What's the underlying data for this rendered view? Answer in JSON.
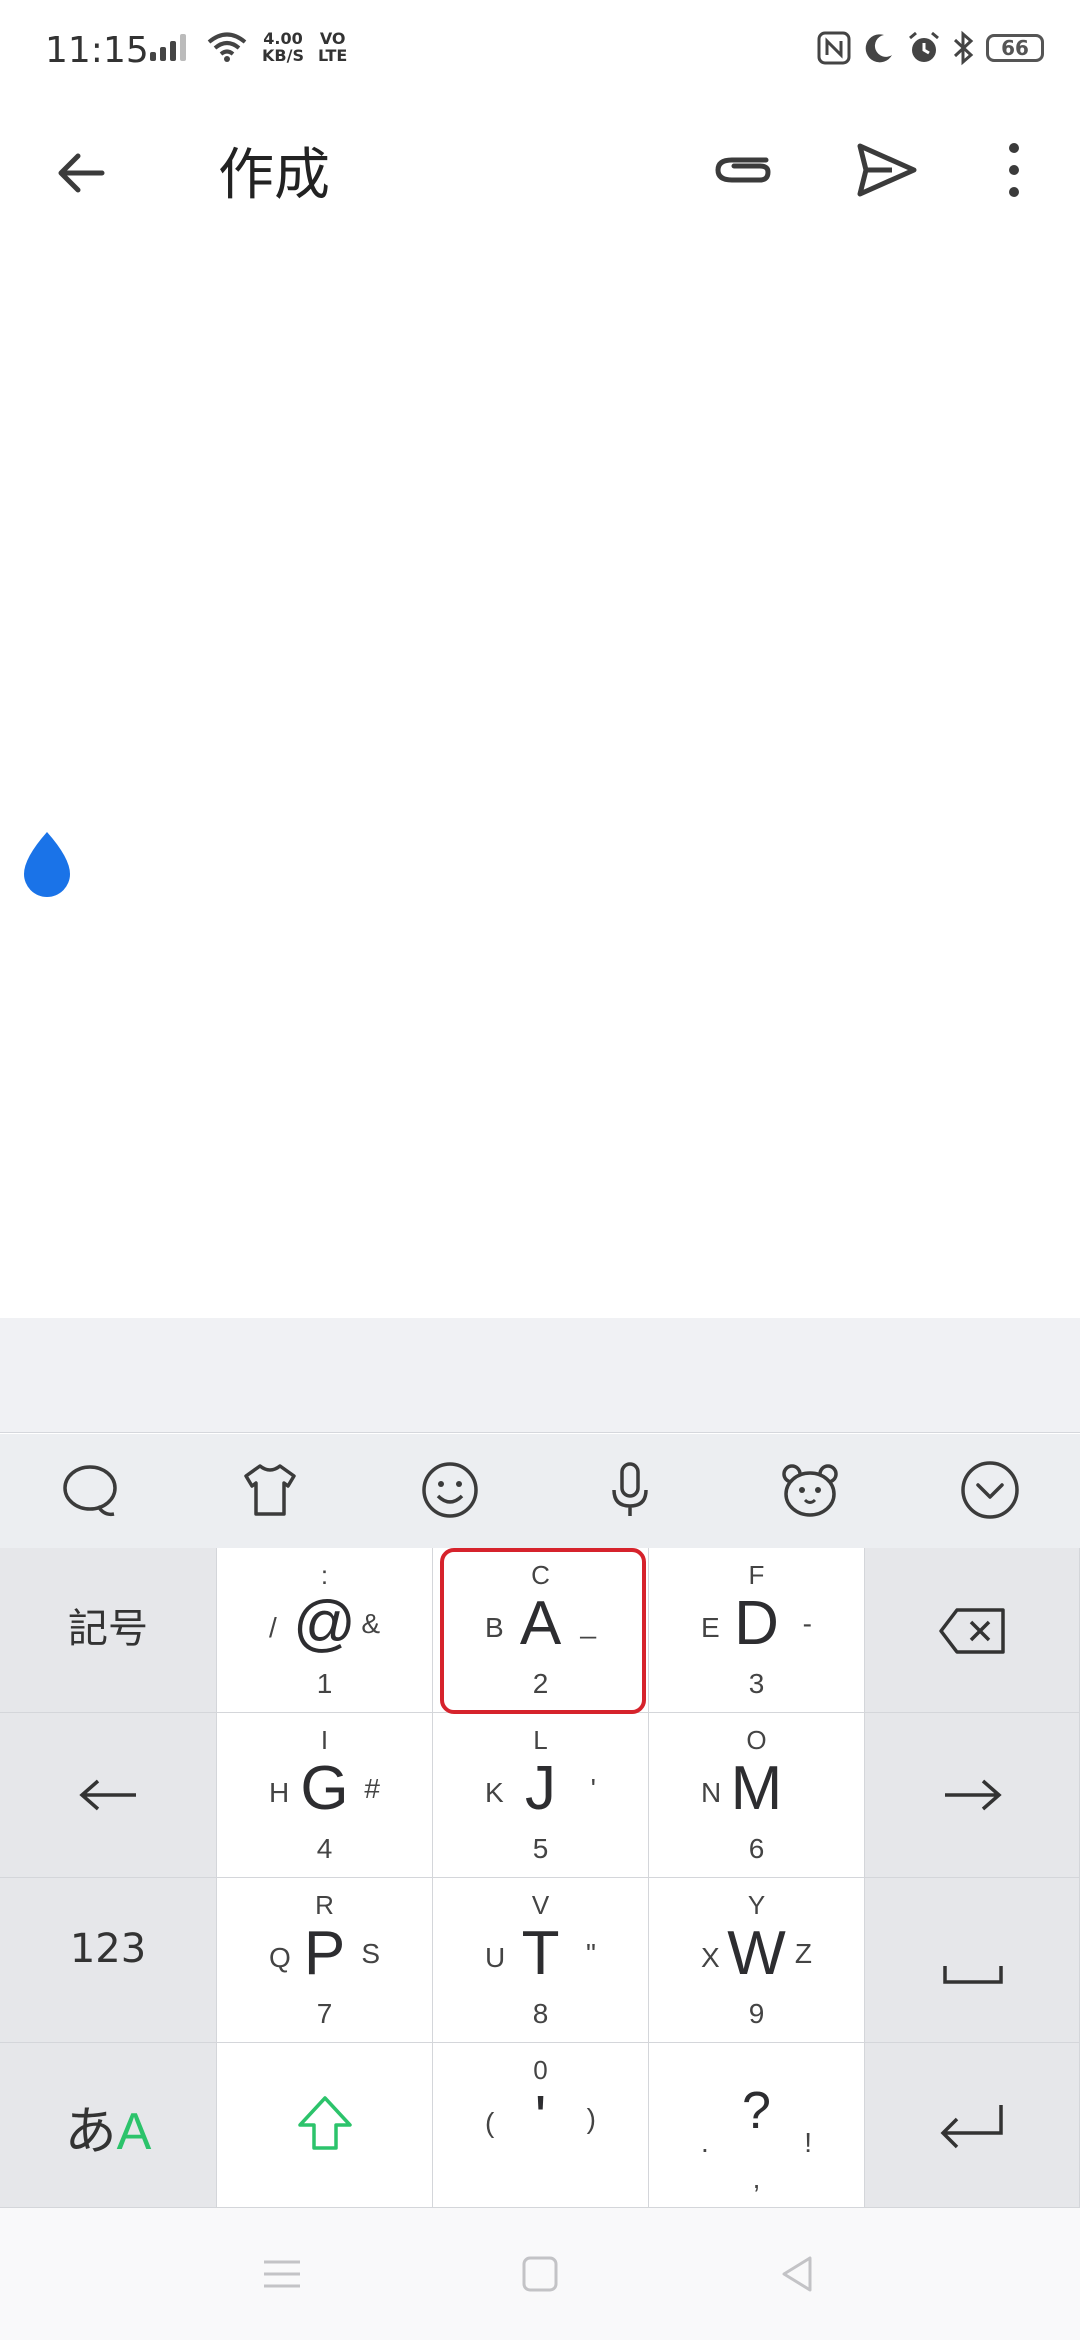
{
  "status": {
    "time": "11:15",
    "speed_top": "4.00",
    "speed_bottom": "KB/S",
    "volte_top": "VO",
    "volte_bottom": "LTE",
    "battery": "66"
  },
  "appbar": {
    "title": "作成"
  },
  "keyboard": {
    "side_left": [
      "記号",
      "",
      "123",
      ""
    ],
    "lang_toggle_a": "あ",
    "lang_toggle_b": "A",
    "keys": [
      {
        "top": ":",
        "left": "/",
        "main": "@",
        "right": "&",
        "bottom": "1"
      },
      {
        "top": "C",
        "left": "B",
        "main": "A",
        "right": "_",
        "bottom": "2"
      },
      {
        "top": "F",
        "left": "E",
        "main": "D",
        "right": "-",
        "bottom": "3"
      },
      {
        "top": "I",
        "left": "H",
        "main": "G",
        "right": "#",
        "bottom": "4"
      },
      {
        "top": "L",
        "left": "K",
        "main": "J",
        "right": "'",
        "bottom": "5"
      },
      {
        "top": "O",
        "left": "N",
        "main": "M",
        "right": "",
        "bottom": "6"
      },
      {
        "top": "R",
        "left": "Q",
        "main": "P",
        "right": "S",
        "bottom": "7"
      },
      {
        "top": "V",
        "left": "U",
        "main": "T",
        "right": "\"",
        "bottom": "8"
      },
      {
        "top": "Y",
        "left": "X",
        "main": "W",
        "right": "Z",
        "bottom": "9"
      },
      {
        "top": "0",
        "left": "(",
        "main": "'",
        "right": ")",
        "bottom": ""
      },
      {
        "top": "",
        "left": ".",
        "main": "?",
        "right": "!",
        "bottom": ","
      }
    ]
  },
  "colors": {
    "accent_green": "#2cc36b",
    "cursor_blue": "#1a73e8",
    "selection_red": "#d6232c"
  }
}
